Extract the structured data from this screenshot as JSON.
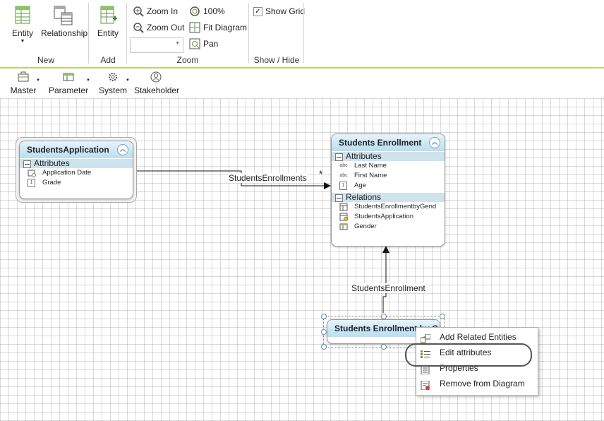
{
  "ribbon": {
    "groups": [
      {
        "label": "New",
        "buttons": [
          {
            "label": "Entity",
            "icon": "entity-icon",
            "has_dropdown": true
          },
          {
            "label": "Relationship",
            "icon": "relationship-icon"
          }
        ]
      },
      {
        "label": "Add",
        "buttons": [
          {
            "label": "Entity",
            "icon": "add-entity-icon"
          }
        ]
      },
      {
        "label": "Zoom",
        "buttons": [
          {
            "label": "Zoom In",
            "icon": "zoom-in-icon"
          },
          {
            "label": "Zoom Out",
            "icon": "zoom-out-icon"
          },
          {
            "label": "100%",
            "icon": "zoom-100-icon"
          },
          {
            "label": "Fit Diagram",
            "icon": "fit-diagram-icon"
          },
          {
            "label": "Pan",
            "icon": "pan-icon"
          }
        ],
        "zoom_select_value": ""
      },
      {
        "label": "Show / Hide",
        "buttons": [
          {
            "label": "Show Grid",
            "icon": "checkbox-icon",
            "checked": true
          }
        ]
      }
    ]
  },
  "toolbar": {
    "items": [
      {
        "label": "Master",
        "icon": "briefcase-icon",
        "has_dropdown": true
      },
      {
        "label": "Parameter",
        "icon": "table-icon",
        "has_dropdown": true
      },
      {
        "label": "System",
        "icon": "gear-icon",
        "has_dropdown": true
      },
      {
        "label": "Stakeholder",
        "icon": "person-icon",
        "has_dropdown": false
      }
    ]
  },
  "diagram": {
    "entities": [
      {
        "title": "StudentsApplication",
        "sections": [
          {
            "label": "Attributes",
            "rows": [
              {
                "icon": "calendar-icon",
                "label": "Application Date"
              },
              {
                "icon": "number-icon",
                "label": "Grade"
              }
            ]
          }
        ]
      },
      {
        "title": "Students Enrollment",
        "sections": [
          {
            "label": "Attributes",
            "rows": [
              {
                "icon": "abc-icon",
                "label": "Last Name"
              },
              {
                "icon": "abc-icon",
                "label": "First Name"
              },
              {
                "icon": "number-icon",
                "label": "Age"
              }
            ]
          },
          {
            "label": "Relations",
            "rows": [
              {
                "icon": "relation-icon",
                "label": "StudentsEnrollmentbyGend"
              },
              {
                "icon": "relation-icon",
                "label": "StudentsApplication"
              },
              {
                "icon": "table-icon",
                "label": "Gender"
              }
            ]
          }
        ]
      },
      {
        "title": "Students Enrollment by G",
        "selected": true
      }
    ],
    "connectors": [
      {
        "label": "StudentsEnrollments",
        "multiplicity": "*"
      },
      {
        "label": "StudentsEnrollment",
        "multiplicity": "*"
      }
    ]
  },
  "context_menu": {
    "items": [
      {
        "label": "Add Related Entities",
        "icon": "add-related-icon"
      },
      {
        "label": "Edit attributes",
        "icon": "edit-attributes-icon",
        "highlighted": true
      },
      {
        "label": "Properties",
        "icon": "properties-icon"
      },
      {
        "label": "Remove from Diagram",
        "icon": "remove-icon"
      }
    ]
  },
  "colors": {
    "accent_line": "#bcd66a",
    "entity_header": "#c4e3f1",
    "section_header": "#cfe3ec",
    "highlight_ring": "#555555"
  }
}
